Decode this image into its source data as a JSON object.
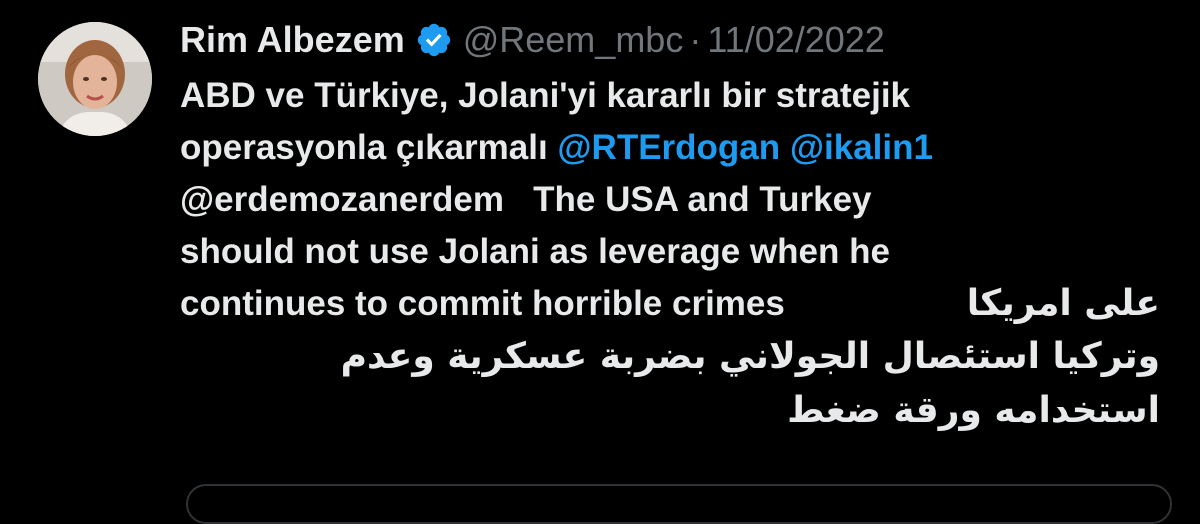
{
  "tweet": {
    "display_name": "Rim Albezem",
    "verified_icon": "verified-badge-icon",
    "handle": "@Reem_mbc",
    "separator": "·",
    "date": "11/02/2022",
    "lines": {
      "l1": "ABD ve Türkiye, Jolani'yi kararlı bir stratejik",
      "l2_text": "operasyonla çıkarmalı ",
      "l2_mention1": "@RTErdogan",
      "l2_space": " ",
      "l2_mention2": "@ikalin1",
      "l3": "@erdemozanerdem   The USA and Turkey",
      "l4": "should not use Jolani as leverage when he",
      "l5_en": "continues to commit horrible crimes",
      "l5_ar": "على امريكا",
      "l6": "وتركيا استئصال الجولاني بضربة عسكرية وعدم",
      "l7": "استخدامه ورقة ضغط"
    }
  },
  "colors": {
    "background": "#000000",
    "text": "#e7e9ea",
    "muted": "#71767b",
    "link": "#1d9bf0",
    "verified": "#1d9bf0"
  }
}
